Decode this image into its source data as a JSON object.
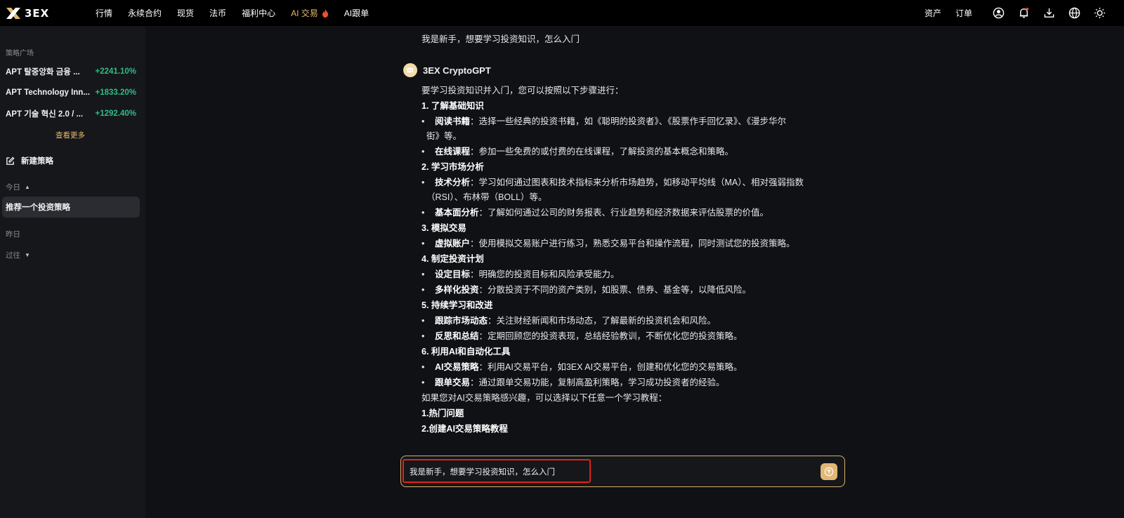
{
  "brand": {
    "name": "3EX"
  },
  "topnav": {
    "items": [
      {
        "label": "行情"
      },
      {
        "label": "永续合约"
      },
      {
        "label": "现货"
      },
      {
        "label": "法币"
      },
      {
        "label": "福利中心"
      },
      {
        "label": "AI 交易",
        "active": true,
        "icon": "fire-icon"
      },
      {
        "label": "AI跟单"
      }
    ],
    "right_links": [
      "资产",
      "订单"
    ],
    "right_icons": [
      "user-icon",
      "bell-icon",
      "download-icon",
      "globe-icon",
      "sun-icon"
    ]
  },
  "sidebar": {
    "section_title": "策略广场",
    "strategies": [
      {
        "name": "APT 탈중앙화 금융 ...",
        "pct": "+2241.10%"
      },
      {
        "name": "APT Technology Inn...",
        "pct": "+1833.20%"
      },
      {
        "name": "APT 기술 혁신 2.0 / ...",
        "pct": "+1292.40%"
      }
    ],
    "see_more": "查看更多",
    "new_strategy": "新建策略",
    "groups": {
      "today": "今日",
      "yesterday": "昨日",
      "past": "过往"
    },
    "history": [
      "推荐一个投资策略"
    ]
  },
  "chat": {
    "user_message_top": "我是新手，想要学习投资知识，怎么入门",
    "bot_name": "3EX CryptoGPT",
    "intro": "要学习投资知识并入门，您可以按照以下步骤进行：",
    "sections": [
      {
        "heading": "1. 了解基础知识"
      },
      {
        "heading": "2. 学习市场分析"
      },
      {
        "heading": "3. 模拟交易"
      },
      {
        "heading": "4. 制定投资计划"
      },
      {
        "heading": "5. 持续学习和改进"
      },
      {
        "heading": "6. 利用AI和自动化工具"
      }
    ],
    "items": {
      "s1a_b": "阅读书籍",
      "s1a_t": "：选择一些经典的投资书籍，如《聪明的投资者》、《股票作手回忆录》、《漫步华尔",
      "s1a_t2": "街》等。",
      "s1b_b": "在线课程",
      "s1b_t": "：参加一些免费的或付费的在线课程，了解投资的基本概念和策略。",
      "s2a_b": "技术分析",
      "s2a_t": "：学习如何通过图表和技术指标来分析市场趋势，如移动平均线（MA）、相对强弱指数",
      "s2a_t2": "（RSI）、布林带（BOLL）等。",
      "s2b_b": "基本面分析",
      "s2b_t": "：了解如何通过公司的财务报表、行业趋势和经济数据来评估股票的价值。",
      "s3a_b": "虚拟账户",
      "s3a_t": "：使用模拟交易账户进行练习，熟悉交易平台和操作流程，同时测试您的投资策略。",
      "s4a_b": "设定目标",
      "s4a_t": "：明确您的投资目标和风险承受能力。",
      "s4b_b": "多样化投资",
      "s4b_t": "：分散投资于不同的资产类别，如股票、债券、基金等，以降低风险。",
      "s5a_b": "跟踪市场动态",
      "s5a_t": "：关注财经新闻和市场动态，了解最新的投资机会和风险。",
      "s5b_b": "反思和总结",
      "s5b_t": "：定期回顾您的投资表现，总结经验教训，不断优化您的投资策略。",
      "s6a_b": "AI交易策略",
      "s6a_t": "：利用AI交易平台，如3EX AI交易平台，创建和优化您的交易策略。",
      "s6b_b": "跟单交易",
      "s6b_t": "：通过跟单交易功能，复制高盈利策略，学习成功投资者的经验。"
    },
    "outro": "如果您对AI交易策略感兴趣，可以选择以下任意一个学习教程：",
    "tutorials": [
      "1.热门问题",
      "2.创建AI交易策略教程"
    ]
  },
  "input": {
    "value": "我是新手，想要学习投资知识，怎么入门"
  },
  "colors": {
    "accent": "#e8b86a",
    "positive": "#2ebd85",
    "highlight": "#e0211c"
  }
}
